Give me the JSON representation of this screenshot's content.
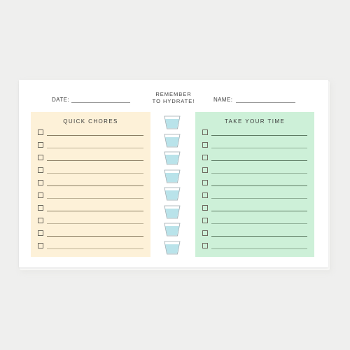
{
  "header": {
    "date_label": "DATE:",
    "reminder_line1": "REMEMBER",
    "reminder_line2": "TO HYDRATE!",
    "name_label": "NAME:"
  },
  "panels": [
    {
      "title": "QUICK CHORES",
      "background": "#fdf1d8",
      "line_color": "#8a7d63",
      "item_count": 10
    },
    {
      "title": "TAKE YOUR TIME",
      "background": "#cdf0d8",
      "line_color": "#5d7a63",
      "item_count": 10
    }
  ],
  "water_tracker": {
    "cup_count": 8,
    "water_color": "#b9e3ea",
    "cup_outline": "#9aa8ad"
  }
}
